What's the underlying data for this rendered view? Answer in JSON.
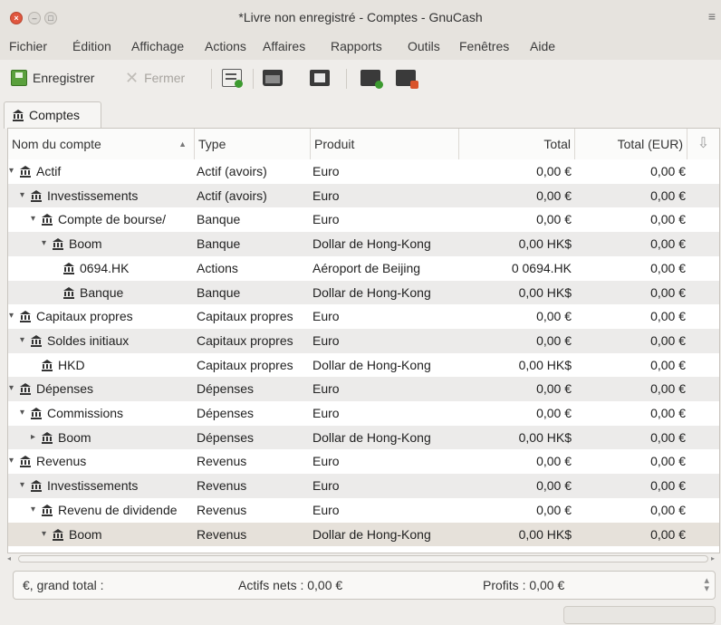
{
  "window": {
    "title": "*Livre non enregistré - Comptes - GnuCash"
  },
  "menubar": {
    "items": [
      "Fichier",
      "Édition",
      "Affichage",
      "Actions",
      "Affaires",
      "Rapports",
      "Outils",
      "Fenêtres",
      "Aide"
    ]
  },
  "toolbar": {
    "save_label": "Enregistrer",
    "close_label": "Fermer"
  },
  "tabs": [
    {
      "label": "Comptes"
    }
  ],
  "columns": {
    "name": "Nom du compte",
    "type": "Type",
    "commodity": "Produit",
    "total": "Total",
    "total_eur": "Total (EUR)"
  },
  "rows": [
    {
      "name": "Actif",
      "expander": "▾",
      "type": "Actif (avoirs)",
      "commodity": "Euro",
      "total": "0,00 €",
      "total_eur": "0,00 €"
    },
    {
      "name": "Investissements",
      "expander": "▾",
      "type": "Actif (avoirs)",
      "commodity": "Euro",
      "total": "0,00 €",
      "total_eur": "0,00 €"
    },
    {
      "name": "Compte de bourse/",
      "expander": "▾",
      "type": "Banque",
      "commodity": "Euro",
      "total": "0,00 €",
      "total_eur": "0,00 €"
    },
    {
      "name": "Boom",
      "expander": "▾",
      "type": "Banque",
      "commodity": "Dollar de Hong-Kong",
      "total": "0,00 HK$",
      "total_eur": "0,00 €"
    },
    {
      "name": "0694.HK",
      "expander": "",
      "type": "Actions",
      "commodity": "Aéroport de Beijing",
      "total": "0 0694.HK",
      "total_eur": "0,00 €"
    },
    {
      "name": "Banque",
      "expander": "",
      "type": "Banque",
      "commodity": "Dollar de Hong-Kong",
      "total": "0,00 HK$",
      "total_eur": "0,00 €"
    },
    {
      "name": "Capitaux propres",
      "expander": "▾",
      "type": "Capitaux propres",
      "commodity": "Euro",
      "total": "0,00 €",
      "total_eur": "0,00 €"
    },
    {
      "name": "Soldes initiaux",
      "expander": "▾",
      "type": "Capitaux propres",
      "commodity": "Euro",
      "total": "0,00 €",
      "total_eur": "0,00 €"
    },
    {
      "name": "HKD",
      "expander": "",
      "type": "Capitaux propres",
      "commodity": "Dollar de Hong-Kong",
      "total": "0,00 HK$",
      "total_eur": "0,00 €"
    },
    {
      "name": "Dépenses",
      "expander": "▾",
      "type": "Dépenses",
      "commodity": "Euro",
      "total": "0,00 €",
      "total_eur": "0,00 €"
    },
    {
      "name": "Commissions",
      "expander": "▾",
      "type": "Dépenses",
      "commodity": "Euro",
      "total": "0,00 €",
      "total_eur": "0,00 €"
    },
    {
      "name": "Boom",
      "expander": "▸",
      "type": "Dépenses",
      "commodity": "Dollar de Hong-Kong",
      "total": "0,00 HK$",
      "total_eur": "0,00 €"
    },
    {
      "name": "Revenus",
      "expander": "▾",
      "type": "Revenus",
      "commodity": "Euro",
      "total": "0,00 €",
      "total_eur": "0,00 €"
    },
    {
      "name": "Investissements",
      "expander": "▾",
      "type": "Revenus",
      "commodity": "Euro",
      "total": "0,00 €",
      "total_eur": "0,00 €"
    },
    {
      "name": "Revenu de dividende",
      "expander": "▾",
      "type": "Revenus",
      "commodity": "Euro",
      "total": "0,00 €",
      "total_eur": "0,00 €"
    },
    {
      "name": "Boom",
      "expander": "▾",
      "type": "Revenus",
      "commodity": "Dollar de Hong-Kong",
      "total": "0,00 HK$",
      "total_eur": "0,00 €"
    }
  ],
  "summary": {
    "currency_label": "€, grand total :",
    "net_assets": "Actifs nets : 0,00 €",
    "profits": "Profits : 0,00 €"
  },
  "colors": {
    "row_alt": "#ecebea",
    "row_plain": "#ffffff",
    "row_selected": "#e6e1da",
    "close_button": "#e0573f"
  },
  "icons": {
    "account": "bank-icon",
    "save": "save-icon",
    "close": "close-icon",
    "sort": "sort-ascending-icon"
  }
}
